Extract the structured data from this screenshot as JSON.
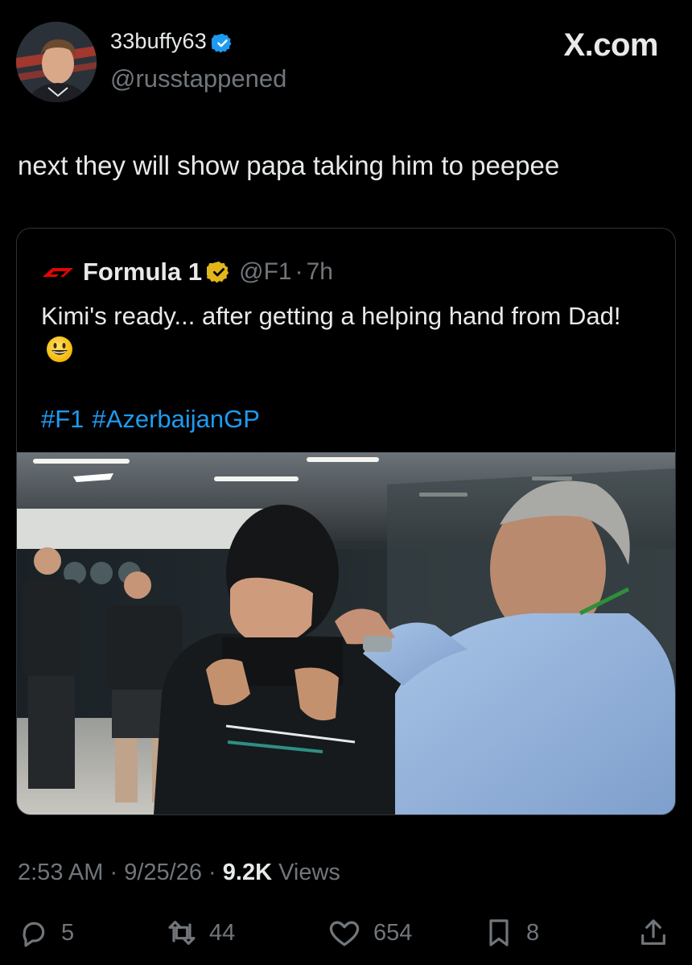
{
  "author": {
    "display_name": "33buffy63",
    "handle": "@russtappened"
  },
  "site": "X.com",
  "tweet_text": "next they will show papa taking him to peepee",
  "quoted": {
    "name": "Formula 1",
    "handle": "@F1",
    "separator": "·",
    "time": "7h",
    "text": "Kimi's ready... after getting a helping hand from Dad!",
    "hashtags": [
      "#F1",
      "#AzerbaijanGP"
    ],
    "photo_logo": "F1"
  },
  "meta": {
    "time": "2:53 AM",
    "date": "9/25/26",
    "views_count": "9.2K",
    "views_label": "Views",
    "sep": "·"
  },
  "actions": {
    "replies": "5",
    "reposts": "44",
    "likes": "654",
    "bookmarks": "8"
  },
  "colors": {
    "background": "#000000",
    "accent": "#1d9bf0",
    "muted": "#71767b",
    "gold": "#e2b719"
  }
}
